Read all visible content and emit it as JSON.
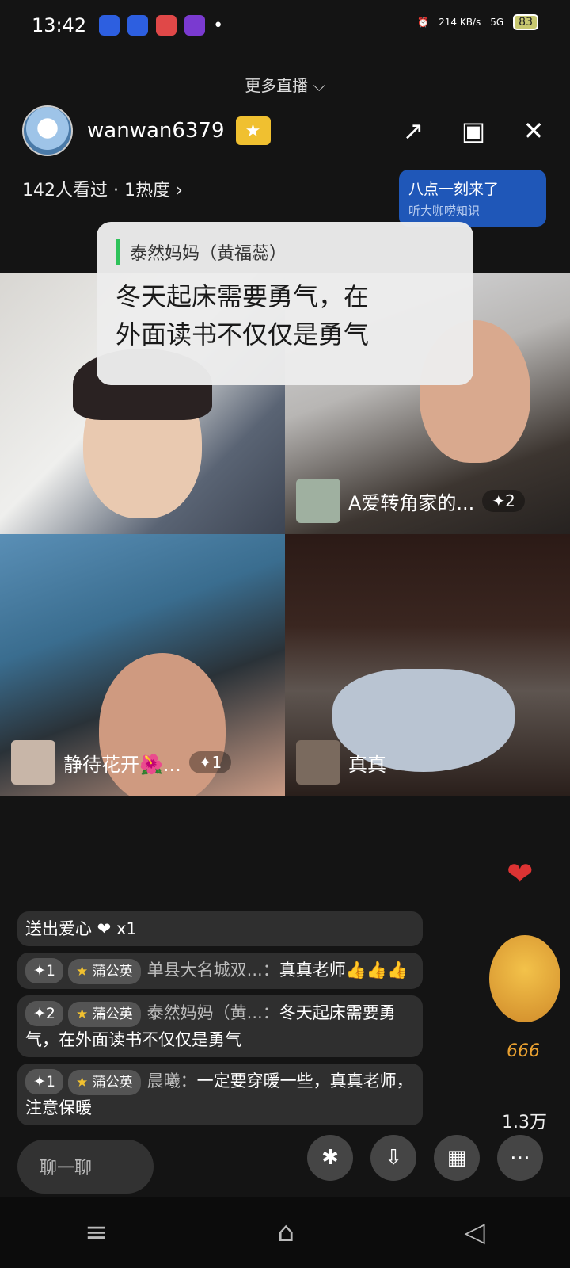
{
  "status_bar": {
    "time": "13:42",
    "speed": "214 KB/s",
    "network": "5G",
    "battery": "83"
  },
  "header": {
    "more_live": "更多直播 ⌵",
    "host_name": "wanwan6379",
    "viewers": "142人看过 · 1热度 ›",
    "promo_line1": "八点一刻来了",
    "promo_line2": "听大咖唠知识"
  },
  "quote": {
    "author": "泰然妈妈（黄福蕊）",
    "text_line1": "冬天起床需要勇气，在",
    "text_line2": "外面读书不仅仅是勇气"
  },
  "tiles": [
    {
      "name": "",
      "count": ""
    },
    {
      "name": "A爱转角家的...",
      "count": "✦2"
    },
    {
      "name": "静待花开🌺...",
      "count": "✦1"
    },
    {
      "name": "真真",
      "count": ""
    }
  ],
  "chat": [
    {
      "level": "",
      "badge": "",
      "user": "",
      "message": "送出爱心 ❤ x1"
    },
    {
      "level": "✦1",
      "badge": "蒲公英",
      "user": "单县大名城双...：",
      "message": "真真老师👍👍👍"
    },
    {
      "level": "✦2",
      "badge": "蒲公英",
      "user": "泰然妈妈（黄...：",
      "message": "冬天起床需要勇气，在外面读书不仅仅是勇气"
    },
    {
      "level": "✦1",
      "badge": "蒲公英",
      "user": "晨曦：",
      "message": "一定要穿暖一些，真真老师，注意保暖"
    }
  ],
  "likes": "1.3万",
  "sticker_text": "666",
  "chat_placeholder": "聊一聊",
  "colors": {
    "accent_green": "#2ec25a",
    "promo_blue": "#1f57b8",
    "heart_red": "#e0202a"
  }
}
